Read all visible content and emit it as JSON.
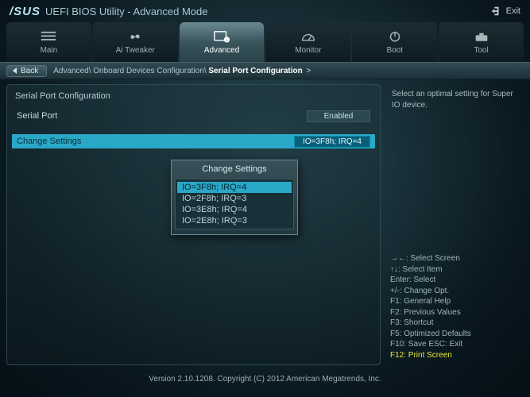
{
  "header": {
    "brand": "/SUS",
    "title": "UEFI BIOS Utility - Advanced Mode",
    "exit_label": "Exit"
  },
  "tabs": [
    {
      "label": "Main"
    },
    {
      "label": "Ai Tweaker"
    },
    {
      "label": "Advanced"
    },
    {
      "label": "Monitor"
    },
    {
      "label": "Boot"
    },
    {
      "label": "Tool"
    }
  ],
  "active_tab": 2,
  "back_label": "Back",
  "breadcrumb": {
    "parts": [
      "Advanced",
      "Onboard Devices Configuration"
    ],
    "current": "Serial Port Configuration"
  },
  "left": {
    "section_title": "Serial Port Configuration",
    "rows": [
      {
        "label": "Serial Port",
        "value": "Enabled",
        "selected": false
      },
      {
        "spacer": true
      },
      {
        "label": "Change Settings",
        "value": "IO=3F8h; IRQ=4",
        "selected": true
      }
    ]
  },
  "popup": {
    "title": "Change Settings",
    "items": [
      {
        "label": "IO=3F8h; IRQ=4",
        "selected": true
      },
      {
        "label": "IO=2F8h; IRQ=3",
        "selected": false
      },
      {
        "label": "IO=3E8h; IRQ=4",
        "selected": false
      },
      {
        "label": "IO=2E8h; IRQ=3",
        "selected": false
      }
    ]
  },
  "help_text": "Select an optimal setting for Super IO device.",
  "keys": [
    "→←: Select Screen",
    "↑↓: Select Item",
    "Enter: Select",
    "+/-: Change Opt.",
    "F1: General Help",
    "F2: Previous Values",
    "F3: Shortcut",
    "F5: Optimized Defaults",
    "F10: Save   ESC: Exit"
  ],
  "keys_highlight": "F12: Print Screen",
  "footer": "Version 2.10.1208. Copyright (C) 2012 American Megatrends, Inc."
}
